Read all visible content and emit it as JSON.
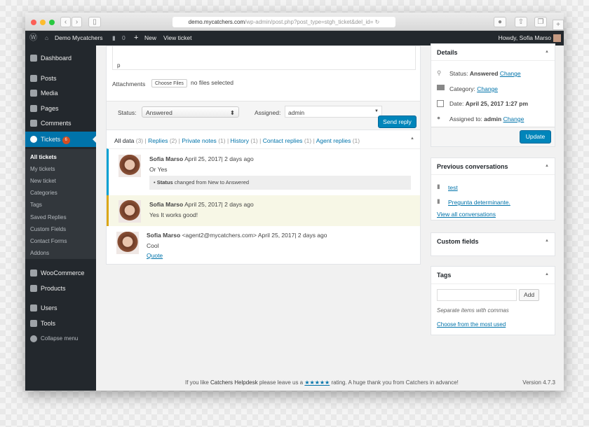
{
  "browser": {
    "url_host": "demo.mycatchers.com",
    "url_path": "/wp-admin/post.php?post_type=stgh_ticket&del_id="
  },
  "adminbar": {
    "site": "Demo Mycatchers",
    "comments": "0",
    "new": "New",
    "view": "View ticket",
    "howdy": "Howdy, Sofia Marso"
  },
  "sidebar": {
    "items": [
      {
        "label": "Dashboard",
        "icon": "dashboard-icon"
      },
      {
        "label": "Posts",
        "icon": "pin-icon"
      },
      {
        "label": "Media",
        "icon": "media-icon"
      },
      {
        "label": "Pages",
        "icon": "pages-icon"
      },
      {
        "label": "Comments",
        "icon": "comment-icon"
      },
      {
        "label": "Tickets",
        "icon": "lifebuoy-icon",
        "badge": "6"
      },
      {
        "label": "WooCommerce",
        "icon": "woo-icon"
      },
      {
        "label": "Products",
        "icon": "box-icon"
      },
      {
        "label": "Users",
        "icon": "user-icon"
      },
      {
        "label": "Tools",
        "icon": "wrench-icon"
      },
      {
        "label": "Collapse menu",
        "icon": "collapse-icon"
      }
    ],
    "submenu": [
      "All tickets",
      "My tickets",
      "New ticket",
      "Categories",
      "Tags",
      "Saved Replies",
      "Custom Fields",
      "Contact Forms",
      "Addons"
    ]
  },
  "editor": {
    "path": "p",
    "attachments_label": "Attachments",
    "choose_files": "Choose Files",
    "no_files": "no files selected",
    "status_label": "Status:",
    "status_value": "Answered",
    "assigned_label": "Assigned:",
    "assigned_value": "admin",
    "send_reply": "Send reply"
  },
  "filters": [
    {
      "label": "All data",
      "count": "(3)"
    },
    {
      "label": "Replies",
      "count": "(2)"
    },
    {
      "label": "Private notes",
      "count": "(1)"
    },
    {
      "label": "History",
      "count": "(1)"
    },
    {
      "label": "Contact replies",
      "count": "(1)"
    },
    {
      "label": "Agent replies",
      "count": "(1)"
    }
  ],
  "messages": [
    {
      "author": "Sofia Marso",
      "meta": "April 25, 2017| 2 days ago",
      "body": "Or Yes",
      "history_field": "Status",
      "history_text": "changed from New to Answered"
    },
    {
      "author": "Sofia Marso",
      "meta": "April 25, 2017| 2 days ago",
      "body": "Yes It works good!"
    },
    {
      "author": "Sofia Marso",
      "meta": "<agent2@mycatchers.com> April 25, 2017| 2 days ago",
      "body": "Cool",
      "quote": "Quote"
    }
  ],
  "details": {
    "title": "Details",
    "status_label": "Status:",
    "status_value": "Answered",
    "change": "Change",
    "category_label": "Category:",
    "date_label": "Date:",
    "date_value": "April 25, 2017 1:27 pm",
    "assigned_label": "Assigned to:",
    "assigned_value": "admin",
    "update": "Update"
  },
  "previous": {
    "title": "Previous conversations",
    "items": [
      "test",
      "Pregunta determinante."
    ],
    "view_all": "View all conversations"
  },
  "custom_fields": {
    "title": "Custom fields"
  },
  "tags": {
    "title": "Tags",
    "add": "Add",
    "hint": "Separate items with commas",
    "choose": "Choose from the most used"
  },
  "footer": {
    "pre": "If you like",
    "brand": "Catchers Helpdesk",
    "mid": "please leave us a",
    "stars": "★★★★★",
    "post": "rating. A huge thank you from Catchers in advance!",
    "version": "Version 4.7.3"
  },
  "colors": {
    "accent": "#0073aa",
    "active_menu": "#0073aa",
    "badge": "#d54e21",
    "note_border": "#dba617",
    "reply_border": "#00a0d2"
  }
}
